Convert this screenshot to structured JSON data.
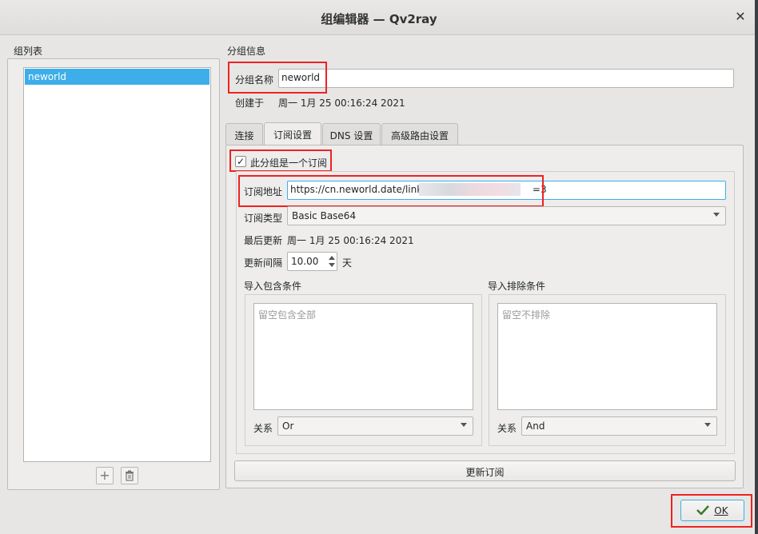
{
  "window": {
    "title": "组编辑器 — Qv2ray",
    "close_glyph": "✕"
  },
  "left": {
    "group_list_label": "组列表",
    "groups": [
      "neworld"
    ]
  },
  "right": {
    "group_info_label": "分组信息",
    "group_name_label": "分组名称",
    "group_name_value": "neworld",
    "created_label": "创建于",
    "created_value": "周一 1月 25 00:16:24 2021",
    "tabs": [
      "连接",
      "订阅设置",
      "DNS 设置",
      "高级路由设置"
    ],
    "active_tab": "订阅设置"
  },
  "subscription": {
    "is_subscription_label": "此分组是一个订阅",
    "is_subscription_checked": true,
    "check_glyph": "✓",
    "address_label": "订阅地址",
    "address_value_start": "https://cn.neworld.date/link/",
    "address_value_end": "=3",
    "type_label": "订阅类型",
    "type_value": "Basic Base64",
    "last_update_label": "最后更新",
    "last_update_value": "周一 1月 25 00:16:24 2021",
    "interval_label": "更新间隔",
    "interval_value": "10.00",
    "interval_unit": "天",
    "include_label": "导入包含条件",
    "include_placeholder": "留空包含全部",
    "include_relation_label": "关系",
    "include_relation_value": "Or",
    "exclude_label": "导入排除条件",
    "exclude_placeholder": "留空不排除",
    "exclude_relation_label": "关系",
    "exclude_relation_value": "And",
    "update_button": "更新订阅"
  },
  "footer": {
    "ok_button": "OK"
  },
  "colors": {
    "selection": "#3daee9",
    "highlight_box": "#ee2222"
  }
}
